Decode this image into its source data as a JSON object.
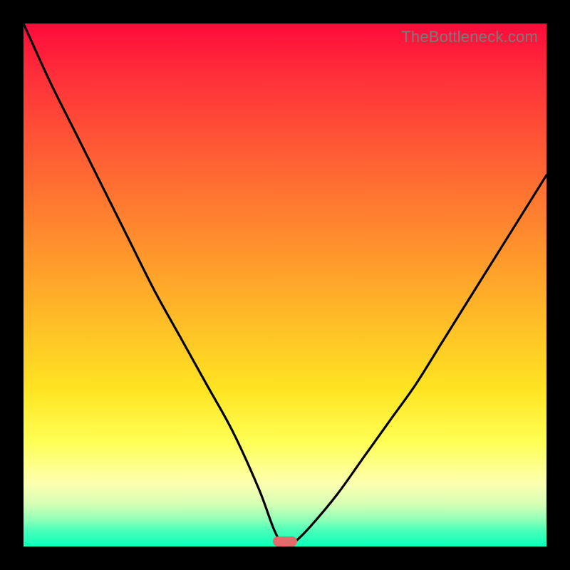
{
  "watermark": "TheBottleneck.com",
  "colors": {
    "frame": "#000000",
    "gradient_top": "#ff0a3b",
    "gradient_mid": "#ffe422",
    "gradient_bottom": "#0bffba",
    "curve": "#000000",
    "marker": "#e26a6a"
  },
  "chart_data": {
    "type": "line",
    "title": "",
    "xlabel": "",
    "ylabel": "",
    "xlim": [
      0,
      100
    ],
    "ylim": [
      0,
      100
    ],
    "series": [
      {
        "name": "bottleneck-curve",
        "x": [
          0,
          5,
          10,
          15,
          20,
          25,
          30,
          35,
          40,
          45,
          48,
          50,
          52,
          55,
          60,
          65,
          70,
          75,
          80,
          85,
          90,
          95,
          100
        ],
        "values": [
          100,
          89,
          79,
          69,
          59,
          49,
          40,
          31,
          22,
          11,
          3,
          0,
          1,
          4,
          10,
          17,
          24,
          31,
          39,
          47,
          55,
          63,
          71
        ]
      }
    ],
    "annotations": [
      {
        "name": "optimal-marker",
        "x": 50,
        "y": 1
      }
    ],
    "grid": false,
    "legend": false
  }
}
